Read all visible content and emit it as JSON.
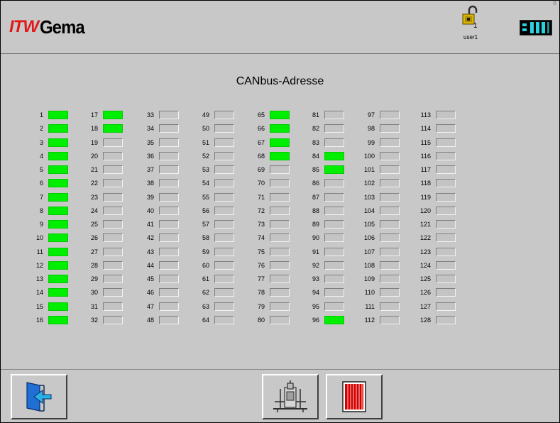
{
  "header": {
    "logo_itw": "ITW",
    "logo_gema": "Gema",
    "corner_text": "8",
    "user": {
      "level": "1",
      "name": "user1",
      "icon": "padlock-open-icon"
    },
    "device_icon": "control-unit-icon"
  },
  "main": {
    "title": "CANbus-Adresse",
    "columns": [
      {
        "numbers": [
          "1",
          "2",
          "3",
          "4",
          "5",
          "6",
          "7",
          "8",
          "9",
          "10",
          "11",
          "12",
          "13",
          "14",
          "15",
          "16"
        ],
        "active": [
          true,
          true,
          true,
          true,
          true,
          true,
          true,
          true,
          true,
          true,
          true,
          true,
          true,
          true,
          true,
          true
        ]
      },
      {
        "numbers": [
          "17",
          "18",
          "19",
          "20",
          "21",
          "22",
          "23",
          "24",
          "25",
          "26",
          "27",
          "28",
          "29",
          "30",
          "31",
          "32"
        ],
        "active": [
          true,
          true,
          false,
          false,
          false,
          false,
          false,
          false,
          false,
          false,
          false,
          false,
          false,
          false,
          false,
          false
        ]
      },
      {
        "numbers": [
          "33",
          "34",
          "35",
          "36",
          "37",
          "38",
          "39",
          "40",
          "41",
          "42",
          "43",
          "44",
          "45",
          "46",
          "47",
          "48"
        ],
        "active": [
          false,
          false,
          false,
          false,
          false,
          false,
          false,
          false,
          false,
          false,
          false,
          false,
          false,
          false,
          false,
          false
        ]
      },
      {
        "numbers": [
          "49",
          "50",
          "51",
          "52",
          "53",
          "54",
          "55",
          "56",
          "57",
          "58",
          "59",
          "60",
          "61",
          "62",
          "63",
          "64"
        ],
        "active": [
          false,
          false,
          false,
          false,
          false,
          false,
          false,
          false,
          false,
          false,
          false,
          false,
          false,
          false,
          false,
          false
        ]
      },
      {
        "numbers": [
          "65",
          "66",
          "67",
          "68",
          "69",
          "70",
          "71",
          "72",
          "73",
          "74",
          "75",
          "76",
          "77",
          "78",
          "79",
          "80"
        ],
        "active": [
          true,
          true,
          true,
          true,
          false,
          false,
          false,
          false,
          false,
          false,
          false,
          false,
          false,
          false,
          false,
          false
        ]
      },
      {
        "numbers": [
          "81",
          "82",
          "83",
          "84",
          "85",
          "86",
          "87",
          "88",
          "89",
          "90",
          "91",
          "92",
          "93",
          "94",
          "95",
          "96"
        ],
        "active": [
          false,
          false,
          false,
          true,
          true,
          false,
          false,
          false,
          false,
          false,
          false,
          false,
          false,
          false,
          false,
          true
        ]
      },
      {
        "numbers": [
          "97",
          "98",
          "99",
          "100",
          "101",
          "102",
          "103",
          "104",
          "105",
          "106",
          "107",
          "108",
          "109",
          "110",
          "111",
          "112"
        ],
        "active": [
          false,
          false,
          false,
          false,
          false,
          false,
          false,
          false,
          false,
          false,
          false,
          false,
          false,
          false,
          false,
          false
        ]
      },
      {
        "numbers": [
          "113",
          "114",
          "115",
          "116",
          "117",
          "118",
          "119",
          "120",
          "121",
          "122",
          "123",
          "124",
          "125",
          "126",
          "127",
          "128"
        ],
        "active": [
          false,
          false,
          false,
          false,
          false,
          false,
          false,
          false,
          false,
          false,
          false,
          false,
          false,
          false,
          false,
          false
        ]
      }
    ]
  },
  "footer": {
    "buttons": [
      {
        "name": "exit-button",
        "icon": "exit-door-icon"
      },
      {
        "name": "gun-unit-button",
        "icon": "spray-gun-unit-icon"
      },
      {
        "name": "grid-button",
        "icon": "red-grid-icon"
      }
    ]
  },
  "colors": {
    "active": "#00ee00",
    "inactive": "#c4c4c4",
    "background": "#c8c8c8",
    "logo_red": "#e01a1a"
  }
}
